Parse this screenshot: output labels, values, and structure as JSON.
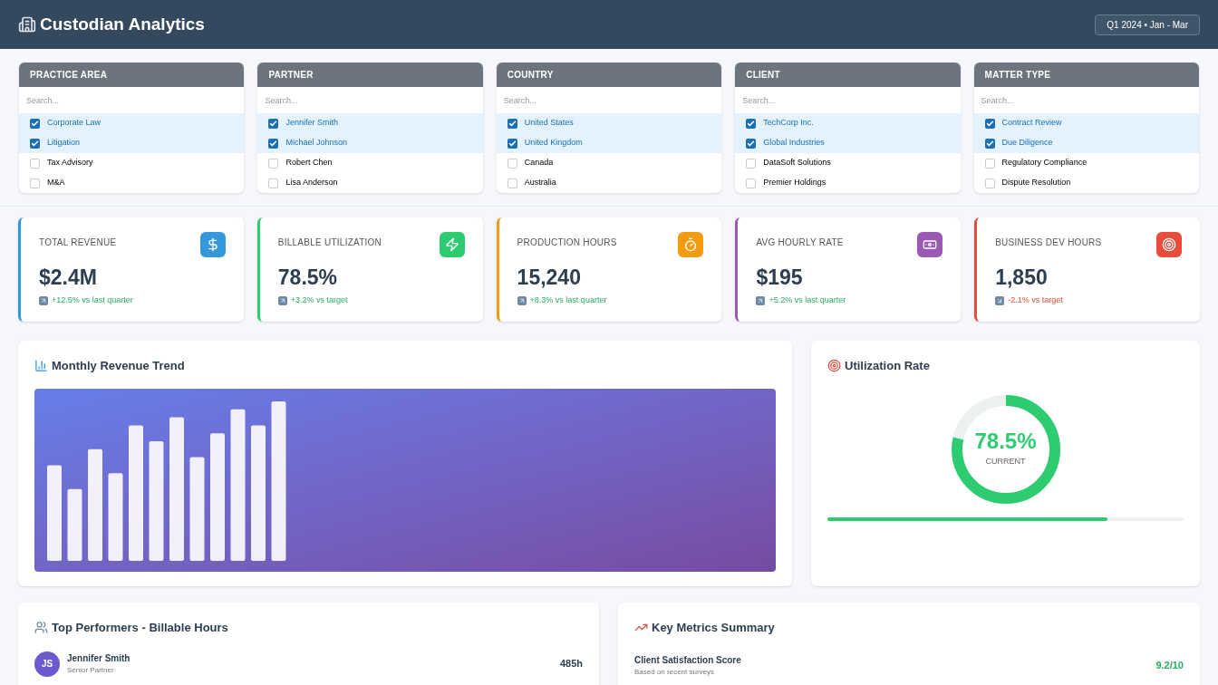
{
  "header": {
    "title": "Custodian Analytics",
    "period": "Q1 2024 • Jan - Mar"
  },
  "filters": [
    {
      "title": "PRACTICE AREA",
      "placeholder": "Search...",
      "items": [
        {
          "label": "Corporate Law",
          "checked": true
        },
        {
          "label": "Litigation",
          "checked": true
        },
        {
          "label": "Tax Advisory",
          "checked": false
        },
        {
          "label": "M&A",
          "checked": false
        }
      ]
    },
    {
      "title": "PARTNER",
      "placeholder": "Search...",
      "items": [
        {
          "label": "Jennifer Smith",
          "checked": true
        },
        {
          "label": "Michael Johnson",
          "checked": true
        },
        {
          "label": "Robert Chen",
          "checked": false
        },
        {
          "label": "Lisa Anderson",
          "checked": false
        }
      ]
    },
    {
      "title": "COUNTRY",
      "placeholder": "Search...",
      "items": [
        {
          "label": "United States",
          "checked": true
        },
        {
          "label": "United Kingdom",
          "checked": true
        },
        {
          "label": "Canada",
          "checked": false
        },
        {
          "label": "Australia",
          "checked": false
        }
      ]
    },
    {
      "title": "CLIENT",
      "placeholder": "Search...",
      "items": [
        {
          "label": "TechCorp Inc.",
          "checked": true
        },
        {
          "label": "Global Industries",
          "checked": true
        },
        {
          "label": "DataSoft Solutions",
          "checked": false
        },
        {
          "label": "Premier Holdings",
          "checked": false
        }
      ]
    },
    {
      "title": "MATTER TYPE",
      "placeholder": "Search...",
      "items": [
        {
          "label": "Contract Review",
          "checked": true
        },
        {
          "label": "Due Diligence",
          "checked": true
        },
        {
          "label": "Regulatory Compliance",
          "checked": false
        },
        {
          "label": "Dispute Resolution",
          "checked": false
        }
      ]
    }
  ],
  "kpis": [
    {
      "label": "TOTAL REVENUE",
      "kind": "money",
      "color": "#3498db",
      "value": "$2.4M",
      "change": "+12.5% vs last quarter",
      "down": false
    },
    {
      "label": "BILLABLE UTILIZATION",
      "kind": "bolt",
      "color": "#2ecc71",
      "value": "78.5%",
      "change": "+3.2% vs target",
      "down": false
    },
    {
      "label": "PRODUCTION HOURS",
      "kind": "timer",
      "color": "#f39c12",
      "value": "15,240",
      "change": "+8.3% vs last quarter",
      "down": false
    },
    {
      "label": "AVG HOURLY RATE",
      "kind": "cash",
      "color": "#9b59b6",
      "value": "$195",
      "change": "+5.2% vs last quarter",
      "down": false
    },
    {
      "label": "BUSINESS DEV HOURS",
      "kind": "target",
      "color": "#e74c3c",
      "value": "1,850",
      "change": "-2.1% vs target",
      "down": true
    }
  ],
  "revenue_chart": {
    "title": "Monthly Revenue Trend"
  },
  "utilization": {
    "title": "Utilization Rate",
    "reading": "78.5%",
    "caption": "CURRENT",
    "level": 0.785
  },
  "performers": {
    "title": "Top Performers - Billable Hours",
    "rows": [
      {
        "initials": "JS",
        "name": "Jennifer Smith",
        "role": "Senior Partner",
        "hours": "485h"
      }
    ]
  },
  "metrics": {
    "title": "Key Metrics Summary",
    "rows": [
      {
        "name": "Client Satisfaction Score",
        "note": "Based on recent surveys",
        "value": "9.2/10"
      }
    ]
  }
}
